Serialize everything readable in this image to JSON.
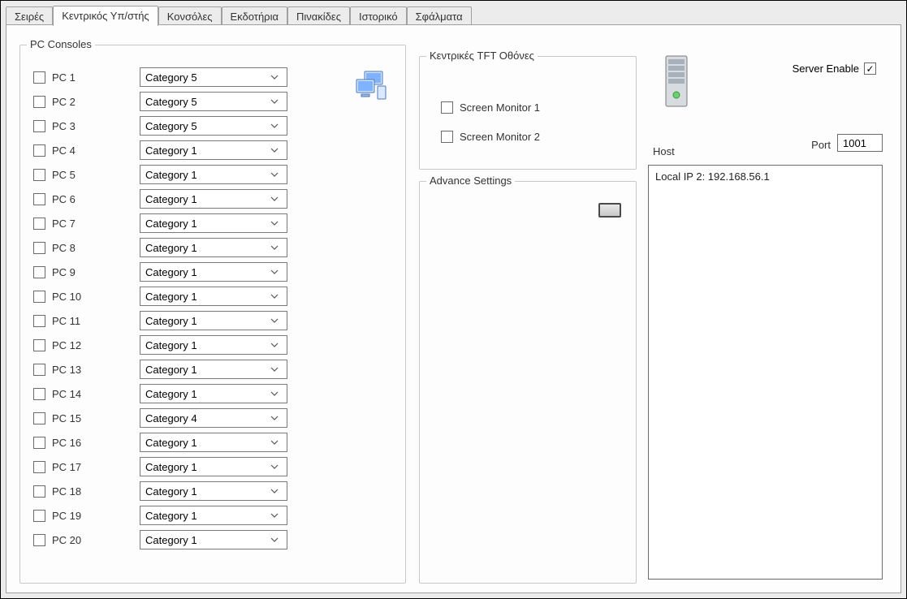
{
  "tabs": [
    "Σειρές",
    "Κεντρικός Υπ/στής",
    "Κονσόλες",
    "Εκδοτήρια",
    "Πινακίδες",
    "Ιστορικό",
    "Σφάλματα"
  ],
  "active_tab_index": 1,
  "pc_consoles": {
    "legend": "PC Consoles",
    "items": [
      {
        "label": "PC 1",
        "checked": false,
        "category": "Category 5"
      },
      {
        "label": "PC 2",
        "checked": false,
        "category": "Category 5"
      },
      {
        "label": "PC 3",
        "checked": false,
        "category": "Category 5"
      },
      {
        "label": "PC 4",
        "checked": false,
        "category": "Category 1"
      },
      {
        "label": "PC 5",
        "checked": false,
        "category": "Category 1"
      },
      {
        "label": "PC 6",
        "checked": false,
        "category": "Category 1"
      },
      {
        "label": "PC 7",
        "checked": false,
        "category": "Category 1"
      },
      {
        "label": "PC 8",
        "checked": false,
        "category": "Category 1"
      },
      {
        "label": "PC 9",
        "checked": false,
        "category": "Category 1"
      },
      {
        "label": "PC 10",
        "checked": false,
        "category": "Category 1"
      },
      {
        "label": "PC 11",
        "checked": false,
        "category": "Category 1"
      },
      {
        "label": "PC 12",
        "checked": false,
        "category": "Category 1"
      },
      {
        "label": "PC 13",
        "checked": false,
        "category": "Category 1"
      },
      {
        "label": "PC 14",
        "checked": false,
        "category": "Category 1"
      },
      {
        "label": "PC 15",
        "checked": false,
        "category": "Category 4"
      },
      {
        "label": "PC 16",
        "checked": false,
        "category": "Category 1"
      },
      {
        "label": "PC 17",
        "checked": false,
        "category": "Category 1"
      },
      {
        "label": "PC 18",
        "checked": false,
        "category": "Category 1"
      },
      {
        "label": "PC 19",
        "checked": false,
        "category": "Category 1"
      },
      {
        "label": "PC 20",
        "checked": false,
        "category": "Category 1"
      }
    ]
  },
  "tft": {
    "legend": "Κεντρικές TFT Οθόνες",
    "items": [
      {
        "label": "Screen Monitor 1",
        "checked": false
      },
      {
        "label": "Screen Monitor 2",
        "checked": false
      }
    ]
  },
  "advance": {
    "legend": "Advance Settings"
  },
  "server": {
    "enable_label": "Server Enable",
    "enable_checked": true,
    "host_label": "Host",
    "port_label": "Port",
    "port_value": "1001",
    "host_lines": [
      "Local IP 2:  192.168.56.1"
    ]
  }
}
